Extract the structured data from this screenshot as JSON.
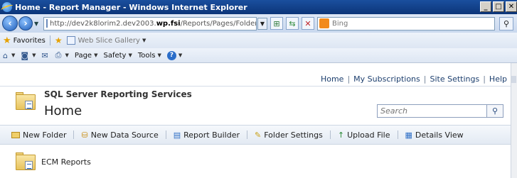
{
  "browser": {
    "window_title": "Home - Report Manager - Windows Internet Explorer",
    "address_prefix": "http://dev2k8lorim2.dev2003.",
    "address_host": "wp.fsi",
    "address_suffix": "/Reports/Pages/Folder.as",
    "search_placeholder": "Bing",
    "favorites_label": "Favorites",
    "web_slice_gallery": "Web Slice Gallery",
    "command_items": [
      "Page",
      "Safety",
      "Tools"
    ]
  },
  "report_manager": {
    "top_links": [
      "Home",
      "My Subscriptions",
      "Site Settings",
      "Help"
    ],
    "product_name": "SQL Server Reporting Services",
    "page_title": "Home",
    "search_placeholder": "Search",
    "toolbar": {
      "new_folder": "New Folder",
      "new_data_source": "New Data Source",
      "report_builder": "Report Builder",
      "folder_settings": "Folder Settings",
      "upload_file": "Upload File",
      "details_view": "Details View"
    },
    "items": [
      {
        "name": "ECM Reports"
      }
    ]
  },
  "colors": {
    "title_bar": "#0c3579",
    "link_color": "#1d3f6e",
    "toolbar_bg": "#e3eaf3"
  },
  "icons": {
    "back": "back-arrow-icon",
    "forward": "forward-arrow-icon",
    "refresh": "refresh-icon",
    "stop": "stop-icon",
    "search": "magnifier-icon",
    "folder": "folder-icon"
  }
}
